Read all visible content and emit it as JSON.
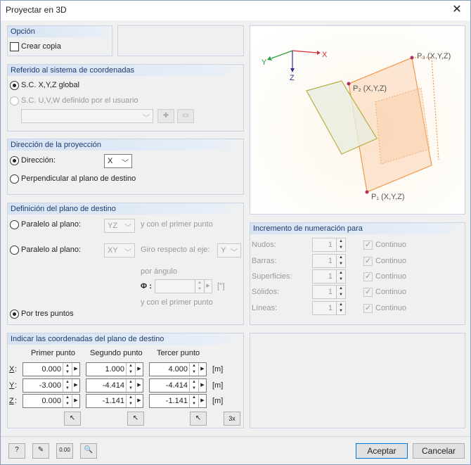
{
  "window": {
    "title": "Proyectar en 3D"
  },
  "opcion": {
    "header": "Opción",
    "crear_copia": "Crear copia"
  },
  "sistema": {
    "header": "Referido al sistema de coordenadas",
    "global": "S.C. X,Y,Z global",
    "usuario": "S.C. U,V,W definido por el usuario"
  },
  "direccion": {
    "header": "Dirección de la proyección",
    "direccion_label": "Dirección:",
    "direccion_value": "X",
    "perpendicular": "Perpendicular al plano de destino"
  },
  "plano": {
    "header": "Definición del plano de destino",
    "paralelo1_label": "Paralelo al plano:",
    "paralelo1_value": "YZ",
    "primer_punto1": "y con el primer punto",
    "paralelo2_label": "Paralelo al plano:",
    "paralelo2_value": "XY",
    "giro_label": "Giro respecto al eje:",
    "giro_value": "Y",
    "por_angulo": "por ángulo",
    "phi_label": "Φ :",
    "phi_unit": "[°]",
    "primer_punto2": "y con el primer punto",
    "tres_puntos": "Por tres puntos"
  },
  "coords": {
    "header": "Indicar las coordenadas del plano de destino",
    "col1": "Primer punto",
    "col2": "Segundo punto",
    "col3": "Tercer punto",
    "unit": "[m]",
    "rows": [
      {
        "axis": "X",
        "p1": "0.000",
        "p2": "1.000",
        "p3": "4.000"
      },
      {
        "axis": "Y",
        "p1": "-3.000",
        "p2": "-4.414",
        "p3": "-4.414"
      },
      {
        "axis": "Z",
        "p1": "0.000",
        "p2": "-1.141",
        "p3": "-1.141"
      }
    ],
    "pick3_label": "3x"
  },
  "preview": {
    "axis_x": "X",
    "axis_y": "Y",
    "axis_z": "Z",
    "p1": "P₁ (X,Y,Z)",
    "p2": "P₂ (X,Y,Z)",
    "p3": "P₃ (X,Y,Z)"
  },
  "incremento": {
    "header": "Incremento de numeración para",
    "items": [
      {
        "label": "Nudos:",
        "value": "1",
        "check": "Continuo"
      },
      {
        "label": "Barras:",
        "value": "1",
        "check": "Continuo"
      },
      {
        "label": "Superficies:",
        "value": "1",
        "check": "Continuo"
      },
      {
        "label": "Sólidos:",
        "value": "1",
        "check": "Continuo"
      },
      {
        "label": "Líneas:",
        "value": "1",
        "check": "Continuo"
      }
    ]
  },
  "footer": {
    "aceptar": "Aceptar",
    "cancelar": "Cancelar",
    "zero_icon_text": "0.00"
  }
}
